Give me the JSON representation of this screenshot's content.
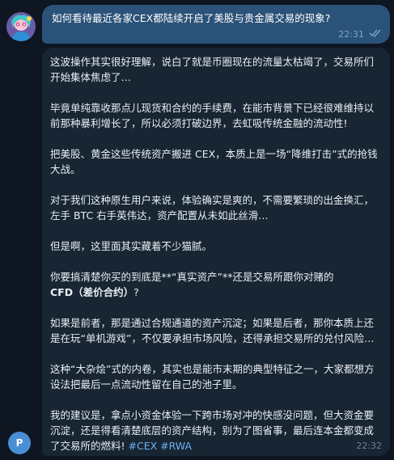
{
  "outgoing": {
    "text": "如何看待最近各家CEX都陆续开启了美股与贵金属交易的现象?",
    "time": "22:31",
    "status_icon": "double-check-icon"
  },
  "incoming": {
    "p1": "这波操作其实很好理解，说白了就是币圈现在的流量太枯竭了，交易所们开始集体焦虑了…",
    "p2": "毕竟单纯靠收那点儿现货和合约的手续费，在能市背景下已经很难维持以前那种暴利增长了，所以必须打破边界，去虹吸传统金融的流动性!",
    "p3": "把美股、黄金这些传统资产搬进 CEX，本质上是一场“降维打击”式的抢钱大战。",
    "p4": "对于我们这种原生用户来说，体验确实是爽的，不需要繁琐的出金换汇，左手 BTC 右手英伟达，资产配置从未如此丝滑…",
    "p5": "但是啊，这里面其实藏着不少猫腻。",
    "p6_a": "你要搞清楚你买的到底是**“真实资产”**还是交易所跟你对赌的",
    "p6_b": "CFD（差价合约）",
    "p6_c": "?",
    "p7": "如果是前者，那是通过合规通道的资产沉淀；如果是后者，那你本质上还是在玩“单机游戏”，不仅要承担市场风险，还得承担交易所的兑付风险…",
    "p8": "这种“大杂烩”式的内卷，其实也是能市末期的典型特征之一，大家都想方设法把最后一点流动性留在自己的池子里。",
    "p9": "我的建议是，拿点小资金体验一下跨市场对冲的快感没问题，但大资金要沉淀，还是得看清楚底层的资产结构，别为了图省事，最后连本金都变成了交易所的燃料!",
    "tag1": "#CEX",
    "tag2": "#RWA",
    "time": "22:32"
  },
  "bot_avatar": {
    "initial": "P",
    "color": "#4a8fd6"
  },
  "colors": {
    "background": "#0e1621",
    "outgoing_bubble": "#2b5278",
    "incoming_bubble": "#182533",
    "hashtag": "#6ab3f3"
  }
}
